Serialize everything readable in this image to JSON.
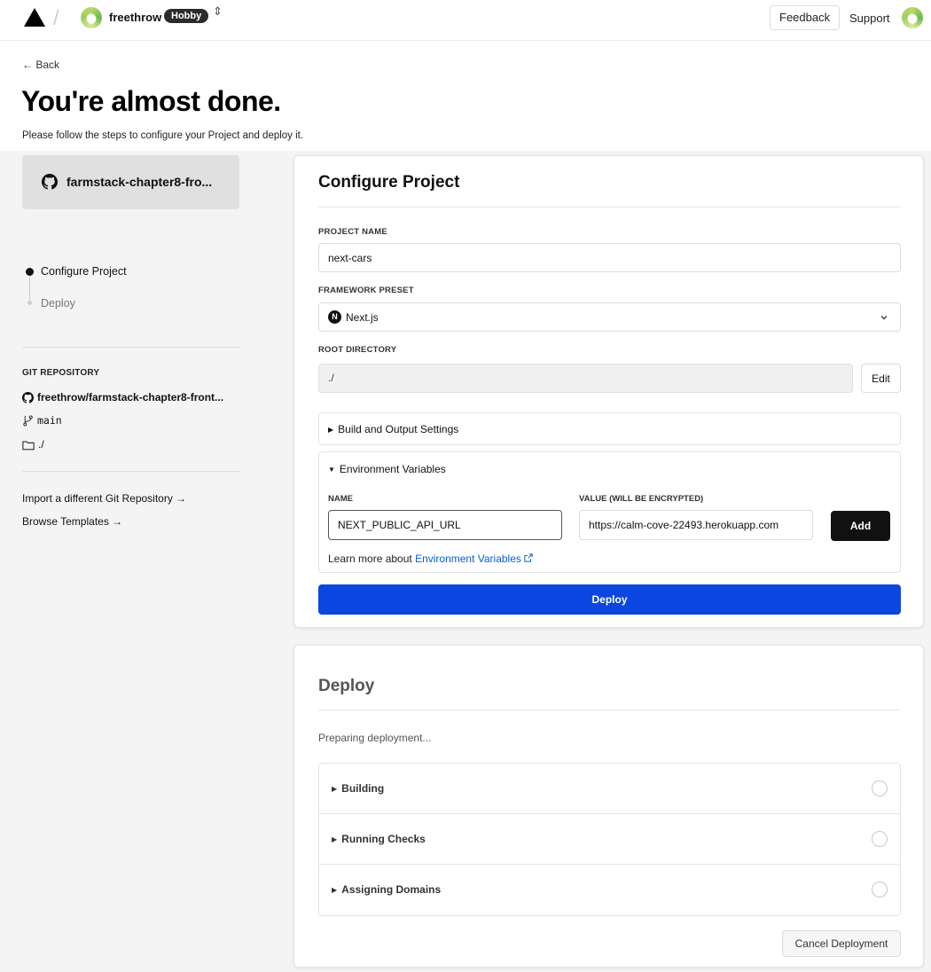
{
  "nav": {
    "team_name": "freethrow",
    "plan_badge": "Hobby",
    "switcher_glyph": "⇕",
    "feedback_label": "Feedback",
    "support_label": "Support"
  },
  "hero": {
    "back_label": "← Back",
    "title": "You're almost done.",
    "subtitle": "Please follow the steps to configure your Project and deploy it."
  },
  "sidebar": {
    "repo_card_name": "farmstack-chapter8-fro...",
    "steps": [
      {
        "label": "Configure Project",
        "active": true
      },
      {
        "label": "Deploy",
        "active": false
      }
    ],
    "git_heading": "GIT REPOSITORY",
    "repo_full_name": "freethrow/farmstack-chapter8-front...",
    "branch": "main",
    "directory": "./",
    "links": [
      {
        "label": "Import a different Git Repository →"
      },
      {
        "label": "Browse Templates →"
      }
    ]
  },
  "configure": {
    "title": "Configure Project",
    "project_name_label": "PROJECT NAME",
    "project_name_value": "next-cars",
    "framework_label": "FRAMEWORK PRESET",
    "framework_value": "Next.js",
    "framework_icon_letter": "N",
    "root_dir_label": "ROOT DIRECTORY",
    "root_dir_value": "./",
    "edit_label": "Edit",
    "build_settings_label": "Build and Output Settings",
    "env": {
      "section_label": "Environment Variables",
      "name_label": "NAME",
      "value_label": "VALUE (WILL BE ENCRYPTED)",
      "name_value": "NEXT_PUBLIC_API_URL",
      "value_value": "https://calm-cove-22493.herokuapp.com",
      "add_label": "Add",
      "learn_more_prefix": "Learn more about ",
      "learn_more_link": "Environment Variables"
    },
    "deploy_label": "Deploy"
  },
  "deploy": {
    "title": "Deploy",
    "status": "Preparing deployment...",
    "stages": [
      {
        "label": "Building"
      },
      {
        "label": "Running Checks"
      },
      {
        "label": "Assigning Domains"
      }
    ],
    "cancel_label": "Cancel Deployment"
  },
  "colors": {
    "deploy_button": "#0b46e0",
    "link": "#0a5bd8",
    "badge": "#2b2b2b"
  },
  "icons": {
    "logo": "triangle-logo-icon",
    "github": "github-icon",
    "branch": "git-branch-icon",
    "folder": "folder-icon",
    "external": "external-link-icon",
    "chevron": "chevron-down-icon"
  }
}
